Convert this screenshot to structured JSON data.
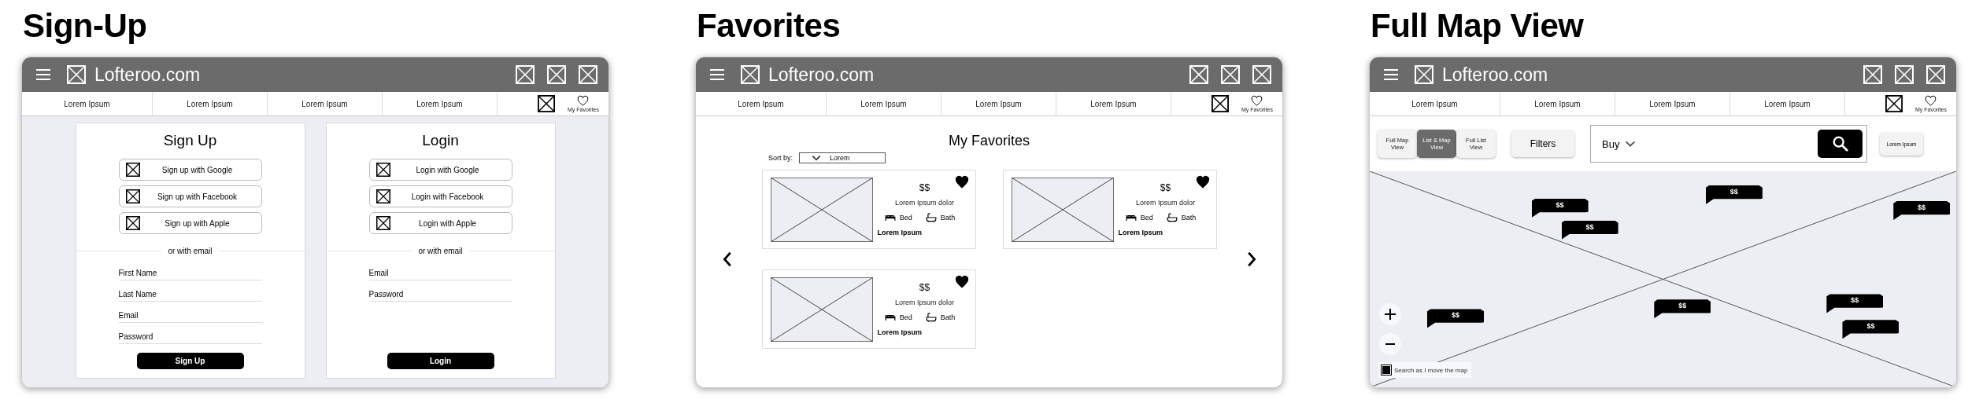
{
  "screens": [
    {
      "kind": "signup",
      "title": "Sign-Up",
      "window": {
        "site_name": "Lofteroo.com",
        "nav_items": [
          "Lorem Ipsum",
          "Lorem Ipsum",
          "Lorem Ipsum",
          "Lorem Ipsum"
        ],
        "favorites_label": "My Favorites"
      },
      "cards": [
        {
          "title": "Sign Up",
          "social_buttons": [
            "Sign up with Google",
            "Sign up with Facebook",
            "Sign up with Apple"
          ],
          "divider": "or with email",
          "fields": [
            {
              "placeholder": "First Name"
            },
            {
              "placeholder": "Last Name"
            },
            {
              "placeholder": "Email"
            },
            {
              "placeholder": "Password"
            }
          ],
          "submit": "Sign Up"
        },
        {
          "title": "Login",
          "social_buttons": [
            "Login with Google",
            "Login with Facebook",
            "Login with Apple"
          ],
          "divider": "or with email",
          "fields": [
            {
              "placeholder": "Email"
            },
            {
              "placeholder": "Password"
            }
          ],
          "submit": "Login"
        }
      ]
    },
    {
      "kind": "favorites",
      "title": "Favorites",
      "window": {
        "site_name": "Lofteroo.com",
        "nav_items": [
          "Lorem Ipsum",
          "Lorem Ipsum",
          "Lorem Ipsum",
          "Lorem Ipsum"
        ],
        "favorites_label": "My Favorites"
      },
      "heading": "My Favorites",
      "sort": {
        "label": "Sort by:",
        "value": "Lorem"
      },
      "listings": [
        {
          "price": "$$",
          "description": "Lorem Ipsum dolor",
          "bed": "Bed",
          "bath": "Bath",
          "name": "Lorem Ipsum",
          "favorited": true
        },
        {
          "price": "$$",
          "description": "Lorem Ipsum dolor",
          "bed": "Bed",
          "bath": "Bath",
          "name": "Lorem Ipsum",
          "favorited": true
        },
        {
          "price": "$$",
          "description": "Lorem Ipsum dolor",
          "bed": "Bed",
          "bath": "Bath",
          "name": "Lorem Ipsum",
          "favorited": true
        }
      ]
    },
    {
      "kind": "map",
      "title": "Full Map View",
      "window": {
        "site_name": "Lofteroo.com",
        "nav_items": [
          "Lorem Ipsum",
          "Lorem Ipsum",
          "Lorem Ipsum",
          "Lorem Ipsum"
        ],
        "favorites_label": "My Favorites"
      },
      "view_options": [
        {
          "label": "Full Map View",
          "selected": false
        },
        {
          "label": "List & Map View",
          "selected": true
        },
        {
          "label": "Full List View",
          "selected": false
        }
      ],
      "filters": "Filters",
      "search": {
        "mode": "Buy"
      },
      "extra_button": "Lorem Ipsum",
      "pins": [
        "$$",
        "$$",
        "$$",
        "$$",
        "$$",
        "$$",
        "$$",
        "$$"
      ],
      "search_as_move": {
        "label": "Search as I move the map",
        "checked": true
      }
    }
  ]
}
